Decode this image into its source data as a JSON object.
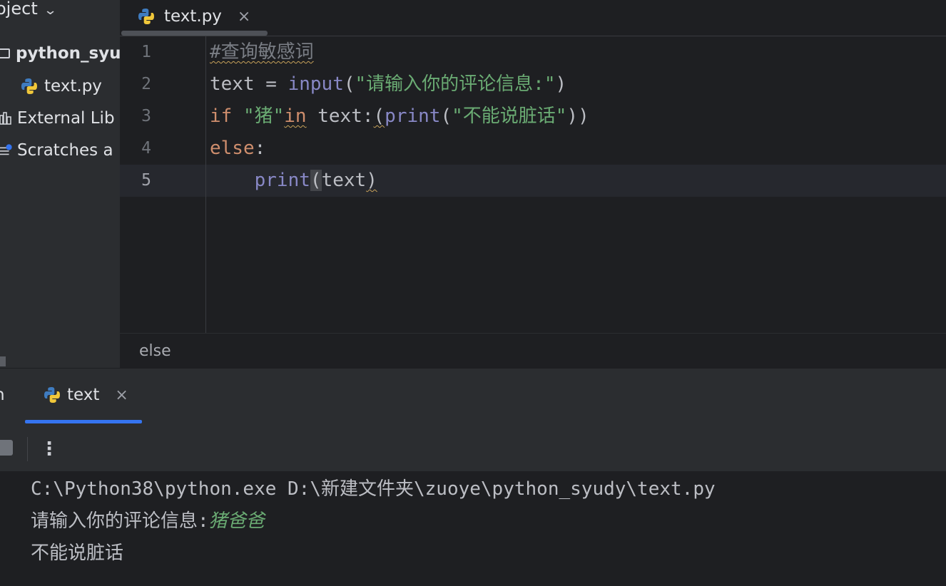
{
  "sidebar": {
    "header": "oject",
    "items": [
      {
        "label": "python_syu",
        "icon": "folder-icon"
      },
      {
        "label": "text.py",
        "icon": "python-icon"
      },
      {
        "label": "External Lib",
        "icon": "library-icon"
      },
      {
        "label": "Scratches a",
        "icon": "scratches-icon"
      }
    ]
  },
  "editor": {
    "tab": {
      "label": "text.py",
      "close": "×"
    },
    "line_numbers": [
      "1",
      "2",
      "3",
      "4",
      "5"
    ],
    "breadcrumb": "else",
    "code": {
      "l1": {
        "comment": "#查询敏感词"
      },
      "l2": {
        "var": "text",
        "assign": " = ",
        "fn": "input",
        "open": "(",
        "str": "\"请输入你的评论信息:\"",
        "close": ")"
      },
      "l3": {
        "kw_if": "if",
        "sp": " ",
        "str": "\"猪\"",
        "kw_in": "in",
        "rest": " text:",
        "open": "(",
        "fn": "print",
        "open2": "(",
        "str2": "\"不能说脏话\"",
        "close": "))"
      },
      "l4": {
        "kw_else": "else",
        "colon": ":"
      },
      "l5": {
        "indent": "    ",
        "fn": "print",
        "open": "(",
        "arg": "text",
        "close": ")"
      }
    }
  },
  "run": {
    "label_cut": "n",
    "tab": {
      "label": "text",
      "close": "×"
    },
    "more": "⋮",
    "console": {
      "cmd": "C:\\Python38\\python.exe D:\\新建文件夹\\zuoye\\python_syudy\\text.py",
      "prompt": "请输入你的评论信息:",
      "input": "猪爸爸",
      "output": "不能说脏话"
    }
  },
  "colors": {
    "keyword": "#cf8e6d",
    "string": "#6aab73",
    "builtin": "#8888c6",
    "accent": "#3574f0"
  }
}
